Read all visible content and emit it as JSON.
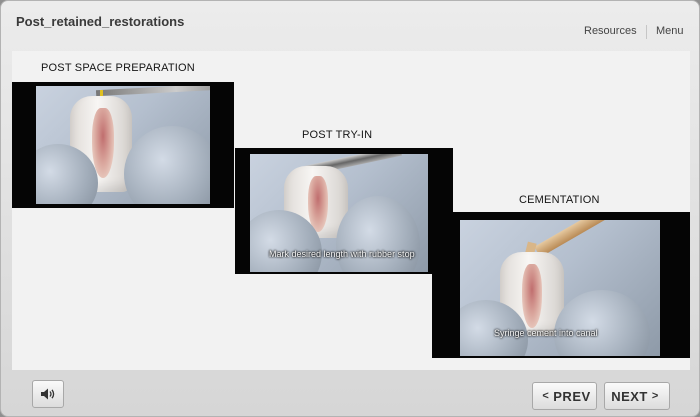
{
  "header": {
    "title": "Post_retained_restorations",
    "nav": {
      "resources": "Resources",
      "menu": "Menu"
    }
  },
  "slides": [
    {
      "caption": "POST SPACE PREPARATION",
      "subtitle": ""
    },
    {
      "caption": "POST TRY-IN",
      "subtitle": "Mark desired length with rubber stop"
    },
    {
      "caption": "CEMENTATION",
      "subtitle": "Syringe cement into canal"
    }
  ],
  "footer": {
    "audio_icon": "speaker-icon",
    "prev_arrow": "<",
    "prev_label": "PREV",
    "next_label": "NEXT",
    "next_arrow": ">"
  }
}
